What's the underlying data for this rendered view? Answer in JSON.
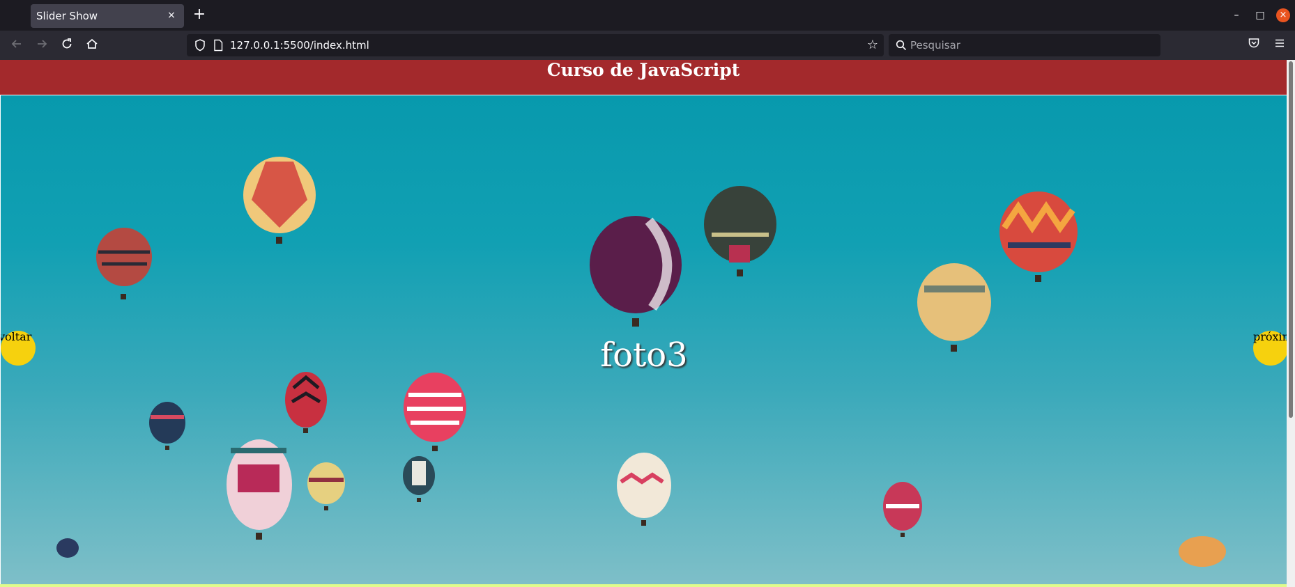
{
  "browser": {
    "tab_title": "Slider Show",
    "tab_close": "×",
    "new_tab": "+",
    "url": "127.0.0.1:5500/index.html",
    "search_placeholder": "Pesquisar",
    "window_controls": {
      "minimize": "–",
      "maximize": "□",
      "close": "×"
    },
    "icons": [
      "back-arrow-icon",
      "forward-arrow-icon",
      "reload-icon",
      "home-icon",
      "shield-icon",
      "page-icon",
      "bookmark-star-icon",
      "search-icon",
      "pocket-icon",
      "menu-icon"
    ]
  },
  "page": {
    "header_title": "Curso de JavaScript",
    "slide_caption": "foto3",
    "prev_label": "voltar",
    "next_label": "próximo",
    "accent_colors": {
      "header": "#a3292c",
      "nav_buttons": "#f6d10e",
      "sky": "#0899ad"
    }
  }
}
